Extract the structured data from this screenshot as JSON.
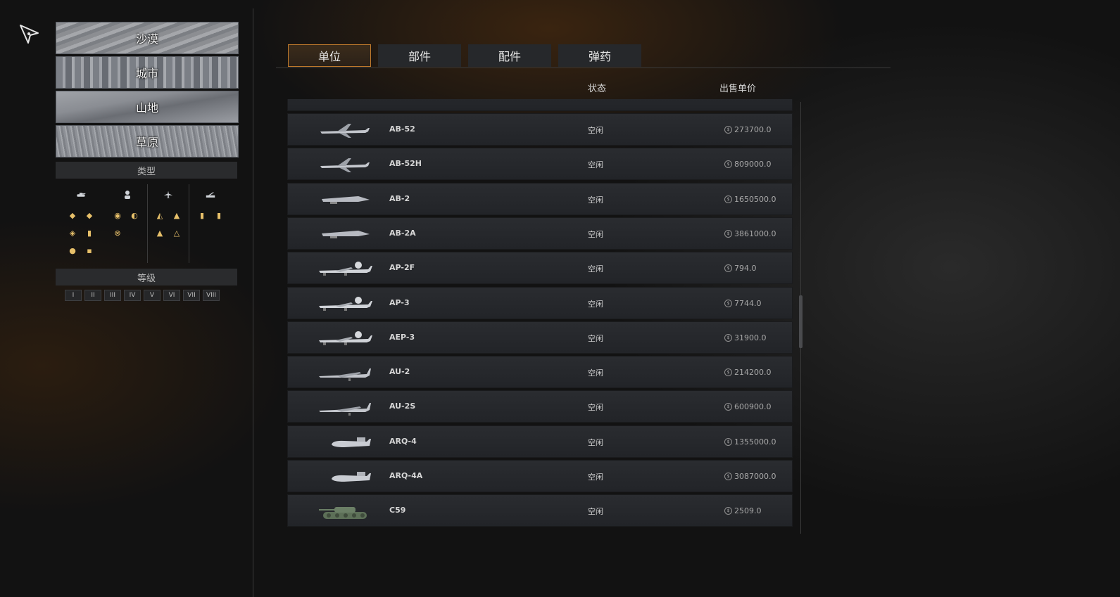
{
  "terrain": [
    "沙漠",
    "城市",
    "山地",
    "草原"
  ],
  "filters": {
    "type_label": "类型",
    "tier_label": "等级"
  },
  "tiers": [
    "I",
    "II",
    "III",
    "IV",
    "V",
    "VI",
    "VII",
    "VIII"
  ],
  "tabs": [
    "单位",
    "部件",
    "配件",
    "弹药"
  ],
  "columns": {
    "status": "状态",
    "price": "出售单价"
  },
  "rows": [
    {
      "name": "AB-52",
      "status": "空闲",
      "price": "273700.0",
      "kind": "bomber"
    },
    {
      "name": "AB-52H",
      "status": "空闲",
      "price": "809000.0",
      "kind": "bomber"
    },
    {
      "name": "AB-2",
      "status": "空闲",
      "price": "1650500.0",
      "kind": "wing"
    },
    {
      "name": "AB-2A",
      "status": "空闲",
      "price": "3861000.0",
      "kind": "wing"
    },
    {
      "name": "AP-2F",
      "status": "空闲",
      "price": "794.0",
      "kind": "prop"
    },
    {
      "name": "AP-3",
      "status": "空闲",
      "price": "7744.0",
      "kind": "prop"
    },
    {
      "name": "AEP-3",
      "status": "空闲",
      "price": "31900.0",
      "kind": "prop"
    },
    {
      "name": "AU-2",
      "status": "空闲",
      "price": "214200.0",
      "kind": "jet"
    },
    {
      "name": "AU-2S",
      "status": "空闲",
      "price": "600900.0",
      "kind": "jet"
    },
    {
      "name": "ARQ-4",
      "status": "空闲",
      "price": "1355000.0",
      "kind": "drone"
    },
    {
      "name": "ARQ-4A",
      "status": "空闲",
      "price": "3087000.0",
      "kind": "drone"
    },
    {
      "name": "C59",
      "status": "空闲",
      "price": "2509.0",
      "kind": "tank"
    }
  ]
}
